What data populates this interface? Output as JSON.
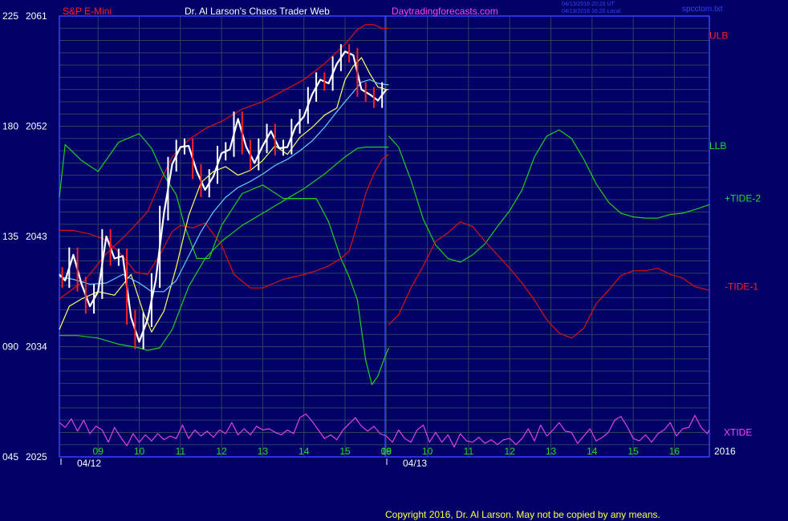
{
  "header": {
    "symbol": "S&P E-Mini",
    "title": "Dr. Al Larson's Chaos Trader Web",
    "site": "Daytradingforecasts.com",
    "stamp_line1": "04/13/2016 20:20 UT",
    "stamp_line2": "04/13/2016 16:20 Local",
    "file": "spcctom.txt",
    "copyright": "Copyright 2016, Dr. Al Larson. May not be copied by any means."
  },
  "chart_data": {
    "type": "line",
    "title": "S&P E-Mini",
    "y_left_ticks": [
      "225",
      "180",
      "135",
      "090",
      "045"
    ],
    "y_price_ticks": [
      "2061",
      "2052",
      "2043",
      "2034",
      "2025"
    ],
    "ylim_price": [
      2025,
      2061
    ],
    "x_hour_labels": [
      "09",
      "10",
      "11",
      "12",
      "13",
      "14",
      "15",
      "16",
      "09",
      "10",
      "11",
      "12",
      "13",
      "14",
      "15",
      "16"
    ],
    "x_date_labels": [
      "04/12",
      "04/13"
    ],
    "year_label": "2016",
    "x_domain": [
      8.06,
      23.85
    ],
    "legend_right": [
      {
        "text": "ULB",
        "color": "#ff2020"
      },
      {
        "text": "LLB",
        "color": "#22dd22"
      },
      {
        "text": "+TIDE-2",
        "color": "#22dd22"
      },
      {
        "text": "-TIDE-1",
        "color": "#ff2020"
      },
      {
        "text": "XTIDE",
        "color": "#ff44ff"
      }
    ],
    "series": [
      {
        "name": "ULB",
        "color": "#dd1111",
        "x": [
          8.06,
          8.7,
          9.2,
          9.7,
          10.2,
          10.5,
          10.8,
          11.2,
          11.6,
          12.0,
          12.5,
          13.0,
          13.5,
          14.0,
          14.5,
          15.0,
          15.3,
          15.5,
          15.7,
          15.9,
          16.0,
          16.06
        ],
        "y": [
          2037.9,
          2039.5,
          2041.6,
          2043.2,
          2045.0,
          2047.4,
          2049.5,
          2050.9,
          2051.8,
          2052.4,
          2053.4,
          2054.0,
          2054.9,
          2055.8,
          2057.1,
          2058.7,
          2059.9,
          2060.3,
          2060.3,
          2060.0,
          2060.0,
          2060.0
        ]
      },
      {
        "name": "LLB",
        "color": "#22cc22",
        "x": [
          8.06,
          8.5,
          9.0,
          9.5,
          10.0,
          10.2,
          10.5,
          10.8,
          11.2,
          11.6,
          12.0,
          12.5,
          13.0,
          13.5,
          14.0,
          14.5,
          15.0,
          15.3,
          15.5,
          15.7,
          15.9,
          16.0,
          16.06
        ],
        "y": [
          2034.9,
          2034.9,
          2034.7,
          2034.2,
          2033.9,
          2033.7,
          2033.9,
          2035.4,
          2038.9,
          2041.2,
          2042.6,
          2043.9,
          2044.9,
          2045.9,
          2046.9,
          2048.1,
          2049.5,
          2050.2,
          2050.3,
          2050.3,
          2050.3,
          2050.3,
          2050.3
        ]
      },
      {
        "name": "TIDE-2",
        "color": "#22cc22",
        "x": [
          8.06,
          8.2,
          8.6,
          9.0,
          9.5,
          10.0,
          10.3,
          10.6,
          10.9,
          11.1,
          11.4,
          11.7,
          12.0,
          12.5,
          13.0,
          13.5,
          14.0,
          14.3,
          14.6,
          14.9,
          15.1,
          15.3,
          15.5,
          15.65,
          15.8,
          15.95,
          16.06
        ],
        "y": [
          2046.2,
          2050.5,
          2049.2,
          2048.3,
          2050.7,
          2051.4,
          2050.2,
          2048.0,
          2046.4,
          2043.9,
          2041.2,
          2041.2,
          2043.9,
          2046.5,
          2047.2,
          2046.1,
          2046.1,
          2046.1,
          2044.2,
          2041.2,
          2039.7,
          2037.8,
          2032.9,
          2030.9,
          2031.6,
          2033.0,
          2033.9
        ]
      },
      {
        "name": "TIDE-1",
        "color": "#dd1111",
        "x": [
          8.06,
          8.4,
          8.8,
          9.2,
          9.6,
          9.9,
          10.2,
          10.5,
          10.8,
          11.0,
          11.3,
          11.6,
          12.0,
          12.3,
          12.7,
          13.0,
          13.5,
          14.0,
          14.3,
          14.6,
          14.9,
          15.1,
          15.3,
          15.5,
          15.7,
          15.9,
          16.06
        ],
        "y": [
          2043.5,
          2043.5,
          2043.2,
          2042.7,
          2041.4,
          2040.1,
          2039.9,
          2041.5,
          2043.4,
          2043.9,
          2043.7,
          2044.1,
          2042.3,
          2039.9,
          2038.8,
          2038.8,
          2039.5,
          2039.9,
          2040.2,
          2040.6,
          2041.2,
          2041.8,
          2044.0,
          2046.5,
          2048.1,
          2049.3,
          2049.7
        ]
      },
      {
        "name": "TIDE-2 projection",
        "color": "#22cc22",
        "x": [
          16.06,
          16.3,
          16.6,
          16.9,
          17.2,
          17.5,
          17.8,
          18.1,
          18.4,
          18.7,
          19.0,
          19.3,
          19.6,
          19.9,
          20.2,
          20.5,
          20.8,
          21.1,
          21.4,
          21.7,
          22.0,
          22.3,
          22.6,
          22.9,
          23.2,
          23.5,
          23.85
        ],
        "y": [
          2051.2,
          2050.3,
          2047.6,
          2044.4,
          2042.3,
          2041.2,
          2040.9,
          2041.5,
          2042.4,
          2043.8,
          2045.1,
          2046.8,
          2049.5,
          2051.2,
          2051.7,
          2051.0,
          2049.3,
          2047.3,
          2045.8,
          2044.9,
          2044.6,
          2044.5,
          2044.5,
          2044.8,
          2044.9,
          2045.2,
          2045.6
        ]
      },
      {
        "name": "TIDE-1 projection",
        "color": "#dd1111",
        "x": [
          16.06,
          16.3,
          16.6,
          16.9,
          17.2,
          17.5,
          17.8,
          18.1,
          18.4,
          18.7,
          19.0,
          19.3,
          19.6,
          19.9,
          20.2,
          20.5,
          20.8,
          21.1,
          21.4,
          21.7,
          22.0,
          22.3,
          22.6,
          22.9,
          23.2,
          23.5,
          23.85
        ],
        "y": [
          2035.8,
          2036.6,
          2038.8,
          2040.6,
          2042.6,
          2043.3,
          2044.2,
          2043.8,
          2042.6,
          2041.5,
          2040.4,
          2039.2,
          2037.8,
          2036.2,
          2035.1,
          2034.7,
          2035.5,
          2037.5,
          2038.6,
          2039.8,
          2040.2,
          2040.2,
          2040.4,
          2039.9,
          2039.6,
          2038.9,
          2038.6
        ]
      },
      {
        "name": "EMA fast",
        "color": "#ffff66",
        "x": [
          8.06,
          8.3,
          8.6,
          9.0,
          9.4,
          9.8,
          10.1,
          10.3,
          10.6,
          10.9,
          11.2,
          11.5,
          11.8,
          12.1,
          12.4,
          12.7,
          13.0,
          13.3,
          13.6,
          13.9,
          14.2,
          14.5,
          14.8,
          15.0,
          15.2,
          15.4,
          15.6,
          15.8,
          16.0,
          16.06
        ],
        "y": [
          2035.4,
          2037.3,
          2037.9,
          2038.5,
          2038.2,
          2039.9,
          2036.8,
          2035.2,
          2036.9,
          2040.5,
          2044.7,
          2047.4,
          2048.3,
          2048.7,
          2048.0,
          2048.4,
          2049.2,
          2050.4,
          2049.7,
          2051.1,
          2051.9,
          2052.9,
          2053.5,
          2055.8,
          2056.9,
          2057.6,
          2056.3,
          2055.2,
          2055.0,
          2055.0
        ]
      },
      {
        "name": "EMA slow",
        "color": "#66ccff",
        "x": [
          8.06,
          8.4,
          8.8,
          9.2,
          9.6,
          10.0,
          10.3,
          10.6,
          10.9,
          11.2,
          11.5,
          11.8,
          12.1,
          12.4,
          12.7,
          13.0,
          13.3,
          13.6,
          13.9,
          14.2,
          14.5,
          14.8,
          15.0,
          15.2,
          15.4,
          15.6,
          15.8,
          16.0,
          16.06
        ],
        "y": [
          2039.7,
          2039.5,
          2039.1,
          2039.2,
          2039.9,
          2039.2,
          2038.5,
          2038.5,
          2039.4,
          2041.4,
          2043.4,
          2045.0,
          2046.2,
          2047.0,
          2047.5,
          2048.1,
          2048.8,
          2049.3,
          2050.0,
          2050.8,
          2051.9,
          2053.2,
          2054.0,
          2054.8,
          2055.6,
          2055.8,
          2055.5,
          2055.4,
          2055.4
        ]
      },
      {
        "name": "Price",
        "color": "#ffffff",
        "x": [
          8.06,
          8.2,
          8.4,
          8.6,
          8.8,
          9.0,
          9.2,
          9.4,
          9.6,
          9.8,
          10.0,
          10.2,
          10.4,
          10.6,
          10.8,
          11.0,
          11.2,
          11.4,
          11.6,
          11.8,
          12.0,
          12.2,
          12.4,
          12.6,
          12.8,
          13.0,
          13.2,
          13.4,
          13.6,
          13.8,
          14.0,
          14.2,
          14.4,
          14.6,
          14.8,
          15.0,
          15.2,
          15.4,
          15.6,
          15.8,
          16.0
        ],
        "y": [
          2039.9,
          2039.4,
          2041.5,
          2039.1,
          2037.3,
          2038.5,
          2043.0,
          2041.2,
          2041.4,
          2036.4,
          2034.4,
          2036.2,
          2039.4,
          2044.9,
          2048.9,
          2050.3,
          2050.4,
          2048.3,
          2046.8,
          2047.9,
          2049.8,
          2050.1,
          2052.6,
          2050.3,
          2049.0,
          2050.4,
          2051.6,
          2050.2,
          2050.3,
          2052.0,
          2052.8,
          2054.6,
          2055.8,
          2055.5,
          2057.1,
          2058.1,
          2057.8,
          2055.0,
          2054.6,
          2054.1,
          2055.0
        ]
      },
      {
        "name": "XTIDE",
        "color": "#dd44dd",
        "x": [
          8.06,
          8.2,
          8.35,
          8.5,
          8.65,
          8.8,
          8.95,
          9.1,
          9.25,
          9.4,
          9.55,
          9.7,
          9.85,
          10.0,
          10.15,
          10.3,
          10.45,
          10.6,
          10.75,
          10.9,
          11.05,
          11.2,
          11.35,
          11.5,
          11.65,
          11.8,
          11.95,
          12.1,
          12.25,
          12.4,
          12.55,
          12.7,
          12.85,
          13.0,
          13.15,
          13.3,
          13.45,
          13.6,
          13.75,
          13.9,
          14.05,
          14.2,
          14.35,
          14.5,
          14.65,
          14.8,
          14.95,
          15.1,
          15.25,
          15.4,
          15.55,
          15.7,
          15.85,
          16.0,
          16.15,
          16.3,
          16.45,
          16.6,
          16.75,
          16.9,
          17.05,
          17.2,
          17.35,
          17.5,
          17.65,
          17.8,
          17.95,
          18.1,
          18.25,
          18.4,
          18.55,
          18.7,
          18.85,
          19.0,
          19.15,
          19.3,
          19.45,
          19.6,
          19.75,
          19.9,
          20.05,
          20.2,
          20.35,
          20.5,
          20.65,
          20.8,
          20.95,
          21.1,
          21.25,
          21.4,
          21.55,
          21.7,
          21.85,
          22.0,
          22.15,
          22.3,
          22.45,
          22.6,
          22.75,
          22.9,
          23.05,
          23.2,
          23.35,
          23.5,
          23.65,
          23.8,
          23.85
        ],
        "y": [
          2027.8,
          2027.4,
          2028.1,
          2027.1,
          2028.0,
          2026.9,
          2027.5,
          2027.2,
          2026.2,
          2027.4,
          2026.6,
          2025.9,
          2026.9,
          2026.2,
          2026.8,
          2026.3,
          2026.9,
          2026.4,
          2026.7,
          2026.5,
          2027.6,
          2026.5,
          2027.2,
          2026.7,
          2027.1,
          2026.6,
          2027.2,
          2026.9,
          2027.8,
          2026.8,
          2027.3,
          2026.8,
          2027.5,
          2027.2,
          2027.3,
          2027.0,
          2026.8,
          2027.2,
          2026.9,
          2028.2,
          2028.5,
          2027.9,
          2027.2,
          2026.5,
          2026.8,
          2026.4,
          2027.2,
          2027.7,
          2028.2,
          2027.5,
          2027.1,
          2027.5,
          2026.9,
          2026.7,
          2026.2,
          2027.2,
          2026.5,
          2026.2,
          2027.2,
          2027.6,
          2026.2,
          2027.0,
          2026.2,
          2026.8,
          2025.8,
          2026.9,
          2026.3,
          2026.2,
          2026.6,
          2026.1,
          2026.4,
          2026.0,
          2026.4,
          2026.5,
          2026.0,
          2026.5,
          2027.3,
          2026.3,
          2027.6,
          2026.7,
          2027.2,
          2027.8,
          2027.1,
          2027.0,
          2026.1,
          2026.7,
          2027.3,
          2026.3,
          2026.6,
          2027.0,
          2028.0,
          2028.3,
          2027.5,
          2026.5,
          2026.3,
          2026.8,
          2026.2,
          2026.9,
          2027.2,
          2027.8,
          2026.7,
          2027.3,
          2027.4,
          2028.4,
          2027.4,
          2026.9,
          2027.2
        ]
      }
    ]
  }
}
